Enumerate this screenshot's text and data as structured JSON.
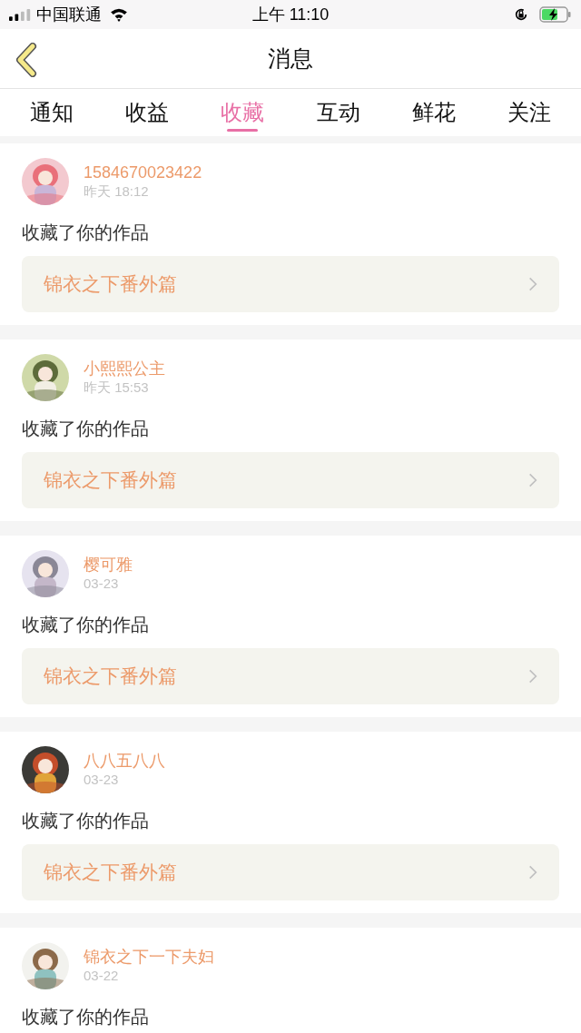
{
  "status_bar": {
    "carrier": "中国联通",
    "time": "上午 11:10"
  },
  "header": {
    "title": "消息"
  },
  "tabs": [
    {
      "label": "通知",
      "selected": false
    },
    {
      "label": "收益",
      "selected": false
    },
    {
      "label": "收藏",
      "selected": true
    },
    {
      "label": "互动",
      "selected": false
    },
    {
      "label": "鲜花",
      "selected": false
    },
    {
      "label": "关注",
      "selected": false
    }
  ],
  "messages": [
    {
      "user": "1584670023422",
      "time": "昨天 18:12",
      "text": "收藏了你的作品",
      "work": "锦衣之下番外篇"
    },
    {
      "user": "小熙熙公主",
      "time": "昨天 15:53",
      "text": "收藏了你的作品",
      "work": "锦衣之下番外篇"
    },
    {
      "user": "樱可雅",
      "time": "03-23",
      "text": "收藏了你的作品",
      "work": "锦衣之下番外篇"
    },
    {
      "user": "八八五八八",
      "time": "03-23",
      "text": "收藏了你的作品",
      "work": "锦衣之下番外篇"
    },
    {
      "user": "锦衣之下一下夫妇",
      "time": "03-22",
      "text": "收藏了你的作品"
    }
  ]
}
